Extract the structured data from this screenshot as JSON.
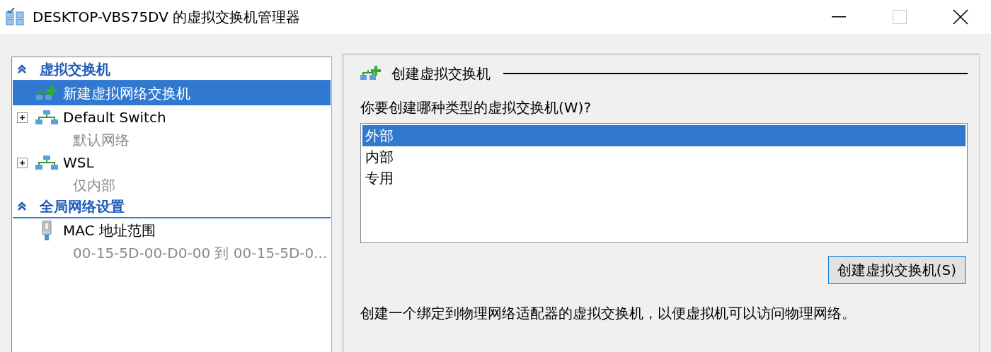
{
  "window": {
    "title": "DESKTOP-VBS75DV 的虚拟交换机管理器",
    "controls": [
      {
        "kind": "minimize",
        "disabled": false
      },
      {
        "kind": "maximize",
        "disabled": true
      },
      {
        "kind": "close",
        "disabled": false
      }
    ]
  },
  "sidebar": {
    "sections": [
      {
        "title": "虚拟交换机",
        "expanded": true,
        "items": [
          {
            "kind": "new",
            "label": "新建虚拟网络交换机",
            "selected": true
          },
          {
            "kind": "switch",
            "label": "Default Switch",
            "sublabel": "默认网络",
            "expanded": false,
            "selected": false
          },
          {
            "kind": "switch",
            "label": "WSL",
            "sublabel": "仅内部",
            "expanded": false,
            "selected": false
          }
        ]
      },
      {
        "title": "全局网络设置",
        "expanded": true,
        "items": [
          {
            "kind": "mac",
            "label": "MAC 地址范围",
            "sublabel": "00-15-5D-00-D0-00 到 00-15-5D-0...",
            "selected": false
          }
        ]
      }
    ]
  },
  "panel": {
    "heading": "创建虚拟交换机",
    "question": "你要创建哪种类型的虚拟交换机(W)?",
    "options": [
      {
        "label": "外部",
        "selected": true
      },
      {
        "label": "内部",
        "selected": false
      },
      {
        "label": "专用",
        "selected": false
      }
    ],
    "button": "创建虚拟交换机(S)",
    "description": "创建一个绑定到物理网络适配器的虚拟交换机，以便虚拟机可以访问物理网络。"
  }
}
